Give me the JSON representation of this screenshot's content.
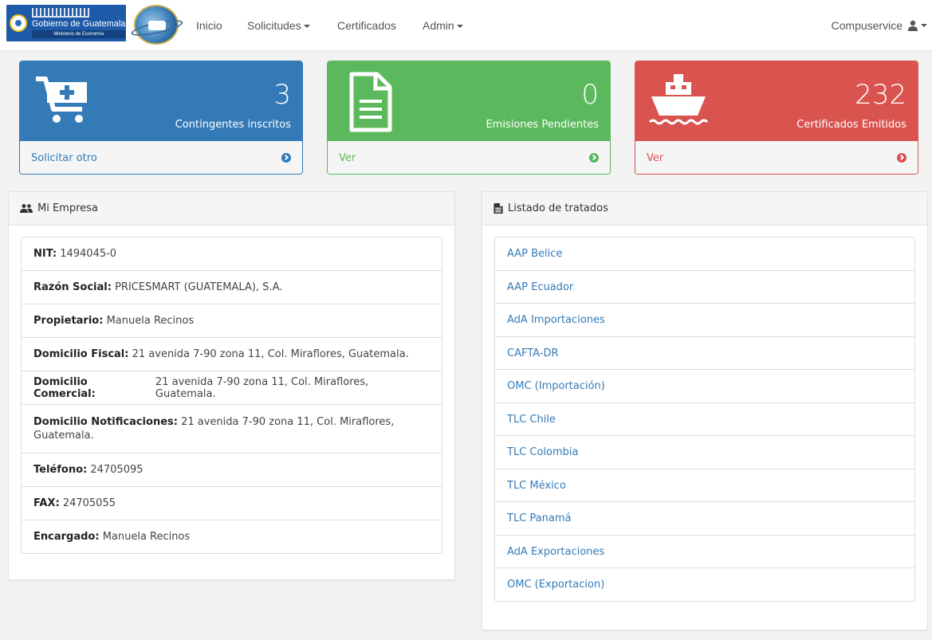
{
  "brand": {
    "gov_name": "Gobierno de Guatemala",
    "ministry": "Ministerio de Economía"
  },
  "nav": {
    "items": [
      {
        "label": "Inicio",
        "dropdown": false
      },
      {
        "label": "Solicitudes",
        "dropdown": true
      },
      {
        "label": "Certificados",
        "dropdown": false
      },
      {
        "label": "Admin",
        "dropdown": true
      }
    ],
    "user": "Compuservice"
  },
  "cards": [
    {
      "color": "#337ab7",
      "icon": "cart-plus-icon",
      "number": "3",
      "label": "Contingentes inscritos",
      "link": "Solicitar otro"
    },
    {
      "color": "#5cb85c",
      "icon": "document-icon",
      "number": "0",
      "label": "Emisiones Pendientes",
      "link": "Ver"
    },
    {
      "color": "#d9534f",
      "icon": "ship-icon",
      "number": "232",
      "label": "Certificados Emitidos",
      "link": "Ver"
    }
  ],
  "company": {
    "title": "Mi Empresa",
    "rows": [
      {
        "key": "NIT:",
        "value": "1494045-0"
      },
      {
        "key": "Razón Social:",
        "value": "PRICESMART (GUATEMALA), S.A."
      },
      {
        "key": "Propietario:",
        "value": "Manuela Recinos"
      },
      {
        "key": "Domicilio Fiscal:",
        "value": "21 avenida 7-90 zona 11, Col. Miraflores, Guatemala."
      },
      {
        "key": "Domicilio Comercial:",
        "value": "21 avenida 7-90 zona 11, Col. Miraflores, Guatemala."
      },
      {
        "key": "Domicilio Notificaciones:",
        "value": "21 avenida 7-90 zona 11, Col. Miraflores, Guatemala."
      },
      {
        "key": "Teléfono:",
        "value": "24705095"
      },
      {
        "key": "FAX:",
        "value": "24705055"
      },
      {
        "key": "Encargado:",
        "value": "Manuela Recinos"
      }
    ]
  },
  "treaties": {
    "title": "Listado de tratados",
    "items": [
      "AAP Belice",
      "AAP Ecuador",
      "AdA Importaciones",
      "CAFTA-DR",
      "OMC (Importación)",
      "TLC Chile",
      "TLC Colombia",
      "TLC México",
      "TLC Panamá",
      "AdA Exportaciones",
      "OMC (Exportacion)"
    ]
  }
}
